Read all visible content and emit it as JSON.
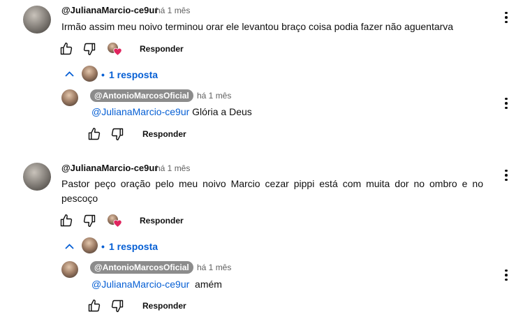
{
  "comments": [
    {
      "author": "@JulianaMarcio-ce9ur",
      "time": "há 1 mês",
      "text": "Irmão assim meu noivo terminou orar ele levantou braço coisa podia fazer não aguentarva",
      "reply_label": "Responder",
      "replies_toggle": "1 resposta",
      "bullet": "•",
      "reply": {
        "author": "@AntonioMarcosOficial",
        "time": "há 1 mês",
        "mention": "@JulianaMarcio-ce9ur",
        "text": " Glória a Deus",
        "reply_label": "Responder"
      }
    },
    {
      "author": "@JulianaMarcio-ce9ur",
      "time": "há 1 mês",
      "text": "Pastor peço oração pelo meu noivo Marcio cezar pippi está com muita dor no ombro e no pescoço",
      "reply_label": "Responder",
      "replies_toggle": "1 resposta",
      "bullet": "•",
      "reply": {
        "author": "@AntonioMarcosOficial",
        "time": "há 1 mês",
        "mention": "@JulianaMarcio-ce9ur",
        "text": "  amém",
        "reply_label": "Responder"
      }
    }
  ],
  "colors": {
    "link": "#065fd4",
    "heart": "#e0245e",
    "pill": "#8c8c8c"
  },
  "icons": [
    "like-icon",
    "dislike-icon",
    "creator-heart-icon",
    "chevron-up-icon",
    "more-vert-icon"
  ]
}
